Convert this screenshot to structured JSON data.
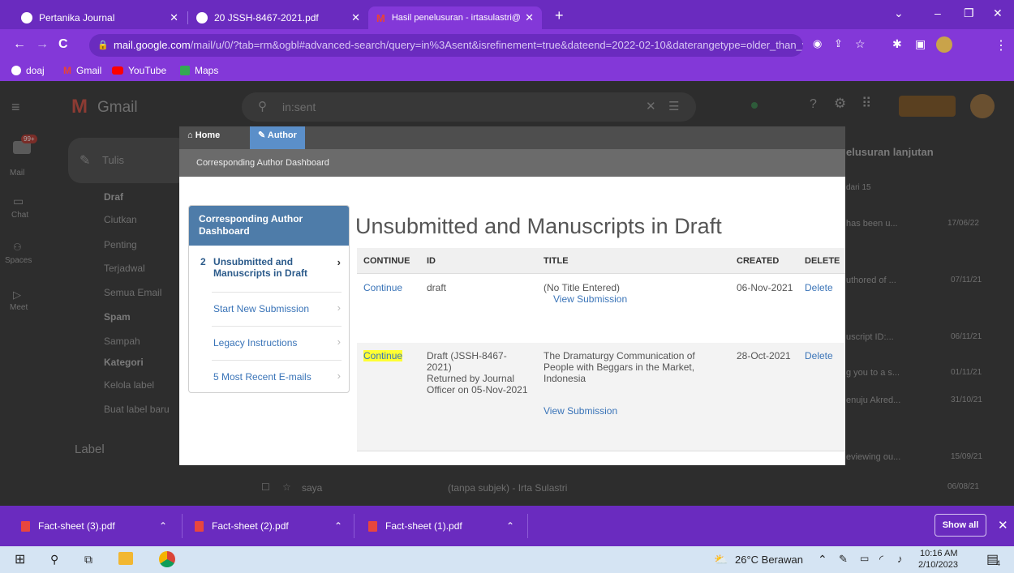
{
  "browser": {
    "tabs": [
      {
        "title": "Pertanika Journal",
        "active": false
      },
      {
        "title": "20 JSSH-8467-2021.pdf",
        "active": false
      },
      {
        "title": "Hasil penelusuran - irtasulastri@",
        "active": true
      }
    ],
    "new_tab": "+",
    "url_host": "mail.google.com",
    "url_path": "/mail/u/0/?tab=rm&ogbl#advanced-search/query=in%3Asent&isrefinement=true&dateend=2022-02-10&daterangetype=older_than_year?...",
    "bookmarks": [
      "doaj",
      "Gmail",
      "YouTube",
      "Maps"
    ]
  },
  "gmail": {
    "app_name": "Gmail",
    "search_value": "in:sent",
    "compose": "Tulis",
    "rail": [
      {
        "label": "Mail",
        "badge": "99+"
      },
      {
        "label": "Chat"
      },
      {
        "label": "Spaces"
      },
      {
        "label": "Meet"
      }
    ],
    "folders": [
      "Draf",
      "Ciutkan",
      "Penting",
      "Terjadwal",
      "Semua Email",
      "Spam",
      "Sampah",
      "Kategori",
      "Kelola label",
      "Buat label baru"
    ],
    "label_header": "Label",
    "right_title": "elusuran lanjutan",
    "pagination": "dari 15",
    "snippets": [
      {
        "text": "has been u...",
        "date": "17/06/22"
      },
      {
        "text": "uthored of ...",
        "date": "07/11/21"
      },
      {
        "text": "uscript ID:...",
        "date": "06/11/21"
      },
      {
        "text": "g you to a s...",
        "date": "01/11/21"
      },
      {
        "text": "enuju Akred...",
        "date": "31/10/21"
      },
      {
        "text": "eviewing ou...",
        "date": "15/09/21"
      }
    ],
    "bottom_row": {
      "sender": "saya",
      "subject": "(tanpa subjek) - Irta Sulastri",
      "date": "06/08/21"
    }
  },
  "modal": {
    "nav": {
      "home": "Home",
      "author": "Author"
    },
    "subheader": "Corresponding Author Dashboard",
    "heading": "Unsubmitted and Manuscripts in Draft",
    "sidebar": {
      "title": "Corresponding Author Dashboard",
      "items": [
        {
          "count": "2",
          "label": "Unsubmitted and Manuscripts in Draft"
        },
        {
          "label": "Start New Submission"
        },
        {
          "label": "Legacy Instructions"
        },
        {
          "label": "5 Most Recent E-mails"
        }
      ]
    },
    "table": {
      "headers": [
        "CONTINUE",
        "ID",
        "TITLE",
        "CREATED",
        "DELETE"
      ],
      "rows": [
        {
          "continue": "Continue",
          "id": "draft",
          "id_note": "",
          "title": "(No Title Entered)",
          "view": "View Submission",
          "created": "06-Nov-2021",
          "delete": "Delete"
        },
        {
          "continue": "Continue",
          "id": "Draft (JSSH-8467-2021)",
          "id_note": "Returned by Journal Officer on 05-Nov-2021",
          "title": "The Dramaturgy Communication of People with Beggars in the Market, Indonesia",
          "view": "View Submission",
          "created": "28-Oct-2021",
          "delete": "Delete"
        }
      ]
    }
  },
  "downloads": {
    "files": [
      "Fact-sheet (3).pdf",
      "Fact-sheet (2).pdf",
      "Fact-sheet (1).pdf"
    ],
    "show_all": "Show all"
  },
  "taskbar": {
    "weather": "26°C Berawan",
    "time": "10:16 AM",
    "date": "2/10/2023",
    "notif_count": "4"
  },
  "colors": {
    "chrome_frame": "#6a2bbf",
    "chrome_toolbar": "#8338d8",
    "modal_sidebar_head": "#4e7ca9",
    "link": "#3a74b8",
    "highlight": "#ffff33"
  }
}
